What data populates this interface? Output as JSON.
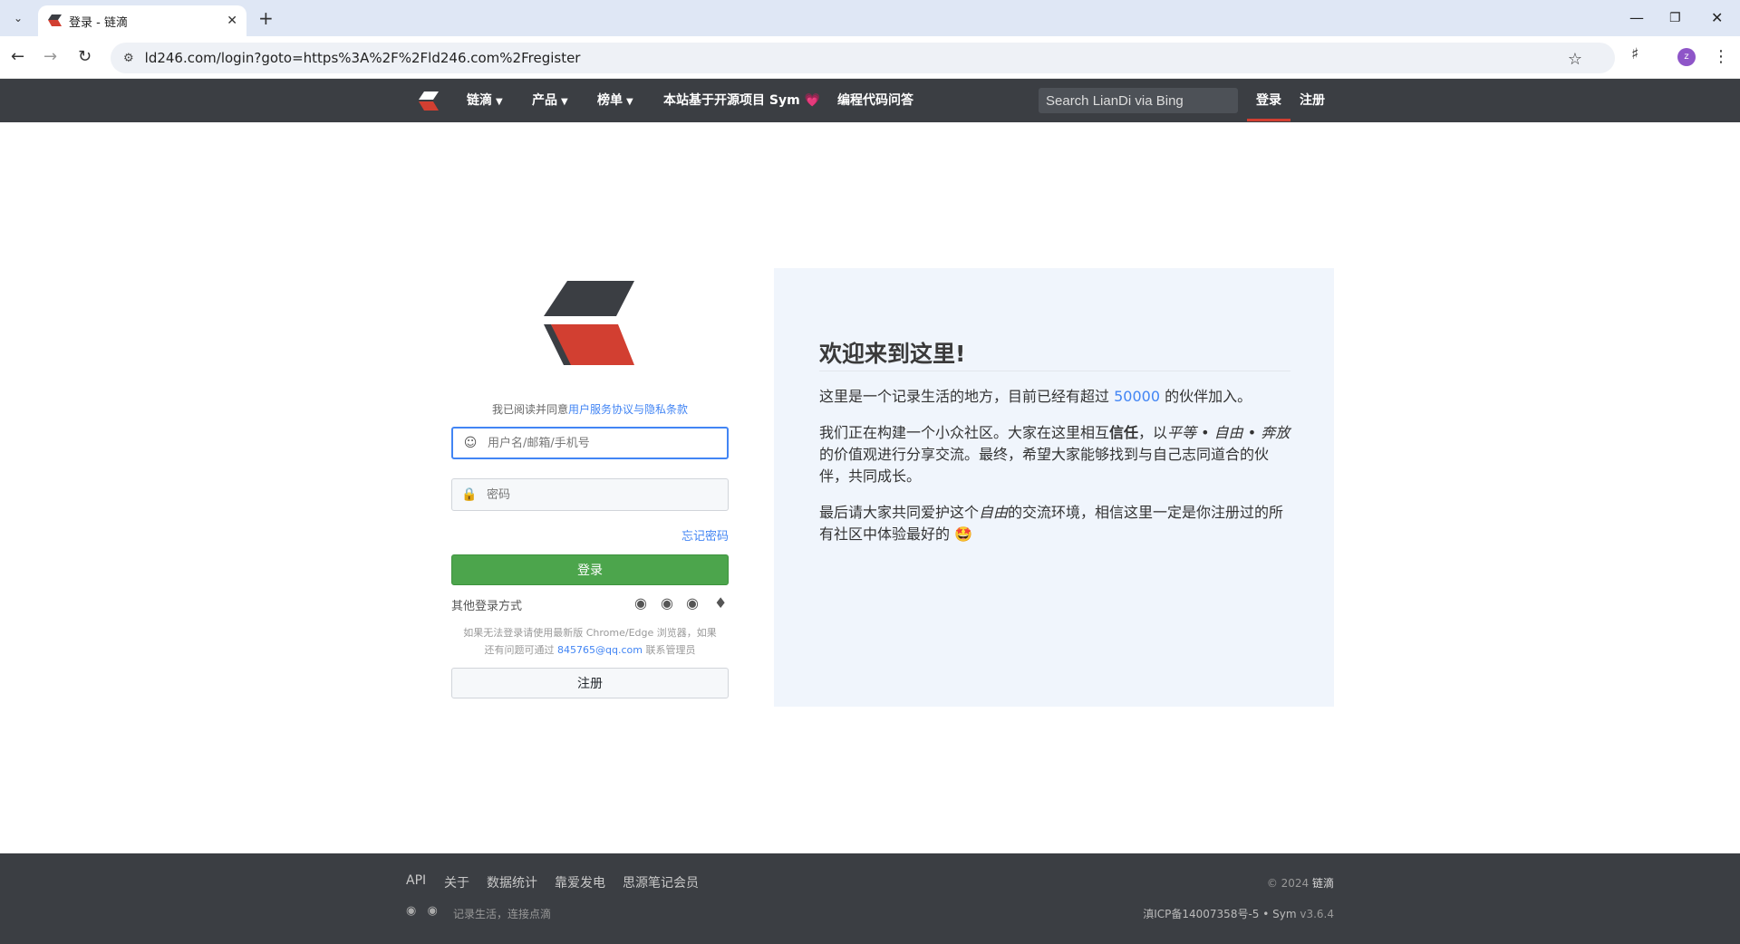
{
  "browser": {
    "tab_title": "登录 - 链滴",
    "url": "ld246.com/login?goto=https%3A%2F%2Fld246.com%2Fregister",
    "profile_initial": "z"
  },
  "header": {
    "nav": [
      {
        "label": "链滴",
        "dropdown": true
      },
      {
        "label": "产品",
        "dropdown": true
      },
      {
        "label": "榜单",
        "dropdown": true
      },
      {
        "label": "本站基于开源项目 Sym",
        "dropdown": false
      },
      {
        "label": "编程代码问答",
        "dropdown": false
      }
    ],
    "heart": "💗",
    "search_placeholder": "Search LianDi via Bing",
    "login_label": "登录",
    "register_label": "注册"
  },
  "login": {
    "agree_prefix": "我已阅读并同意",
    "agree_link": "用户服务协议与隐私条款",
    "username_placeholder": "用户名/邮箱/手机号",
    "password_placeholder": "密码",
    "forgot_label": "忘记密码",
    "login_button": "登录",
    "other_login_label": "其他登录方式",
    "help_line1": "如果无法登录请使用最新版 Chrome/Edge 浏览器，如果",
    "help_line2_prefix": "还有问题可通过 ",
    "help_email": "845765@qq.com",
    "help_line2_suffix": " 联系管理员",
    "register_button": "注册"
  },
  "welcome": {
    "title": "欢迎来到这里!",
    "p1_prefix": "这里是一个记录生活的地方，目前已经有超过 ",
    "p1_number": "50000",
    "p1_suffix": " 的伙伴加入。",
    "p2_a": "我们正在构建一个小众社区。大家在这里相互",
    "p2_bold": "信任",
    "p2_b": "，以",
    "p2_italic": "平等 • 自由 • 奔放",
    "p2_c": "的价值观进行分享交流。最终，希望大家能够找到与自己志同道合的伙伴，共同成长。",
    "p3_a": "最后请大家共同爱护这个",
    "p3_italic": "自由",
    "p3_b": "的交流环境，相信这里一定是你注册过的所有社区中体验最好的 ",
    "p3_emoji": "🤩"
  },
  "footer": {
    "links": [
      "API",
      "关于",
      "数据统计",
      "靠爱发电",
      "思源笔记会员"
    ],
    "copyright_prefix": "© 2024 ",
    "copyright_brand": "链滴",
    "slogan": "记录生活，连接点滴",
    "icp": "滇ICP备14007358号-5 • Sym ",
    "version": "v3.6.4"
  },
  "colors": {
    "header_bg": "#3b3e43",
    "login_button": "#4ca54c",
    "link": "#4285f4",
    "welcome_bg": "#f0f5fc",
    "logo_dark": "#3b3e43",
    "logo_red": "#d23f31"
  }
}
